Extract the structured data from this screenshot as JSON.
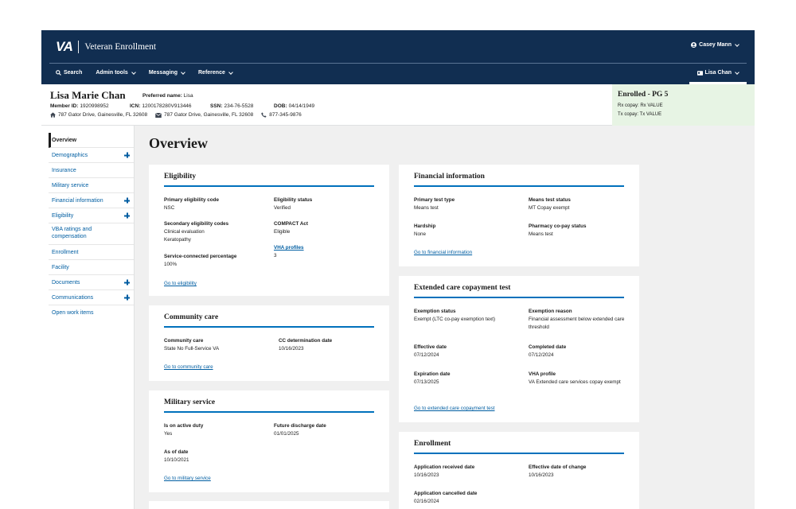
{
  "header": {
    "logo": "VA",
    "app_title": "Veteran Enrollment",
    "user_name": "Casey Mann",
    "nav": [
      "Search",
      "Admin tools",
      "Messaging",
      "Reference"
    ],
    "person_tab": "Lisa Chan"
  },
  "person": {
    "name": "Lisa Marie Chan",
    "preferred_label": "Preferred name:",
    "preferred_value": "Lisa",
    "member_id_label": "Member ID:",
    "member_id": "1920998952",
    "icn_label": "ICN:",
    "icn": "1200178280V913446",
    "ssn_label": "SSN:",
    "ssn": "234-76-5528",
    "dob_label": "DOB:",
    "dob": "04/14/1949",
    "home_address": "787 Gator Drive, Gainesville, FL 32608",
    "mail_address": "787 Gator Drive, Gainesville, FL 32608",
    "phone": "877-345-9876"
  },
  "status": {
    "title": "Enrolled - PG 5",
    "rx": "Rx copay: Rx VALUE",
    "tx": "Tx copay: Tx VALUE"
  },
  "sidebar": {
    "items": [
      {
        "label": "Overview"
      },
      {
        "label": "Demographics"
      },
      {
        "label": "Insurance"
      },
      {
        "label": "Military service"
      },
      {
        "label": "Financial information"
      },
      {
        "label": "Eligibility"
      },
      {
        "label": "VBA ratings and compensation"
      },
      {
        "label": "Enrollment"
      },
      {
        "label": "Facility"
      },
      {
        "label": "Documents"
      },
      {
        "label": "Communications"
      },
      {
        "label": "Open work items"
      }
    ]
  },
  "page_title": "Overview",
  "eligibility": {
    "title": "Eligibility",
    "primary_code_label": "Primary eligibility code",
    "primary_code": "NSC",
    "status_label": "Eligibility status",
    "status": "Verified",
    "secondary_label": "Secondary eligibility codes",
    "secondary_1": "Clinical evaluation",
    "secondary_2": "Keratopathy",
    "compact_label": "COMPACT Act",
    "compact": "Eligible",
    "vha_profiles_label": "VHA profiles",
    "vha_profiles": "3",
    "sc_pct_label": "Service-connected percentage",
    "sc_pct": "100%",
    "link": "Go to eligibility"
  },
  "community_care": {
    "title": "Community care",
    "cc_label": "Community care",
    "cc": "State No Full-Service VA",
    "cc_date_label": "CC determination date",
    "cc_date": "10/16/2023",
    "link": "Go to community care"
  },
  "military": {
    "title": "Military service",
    "active_label": "Is on active duty",
    "active": "Yes",
    "discharge_label": "Future discharge date",
    "discharge": "01/01/2025",
    "asof_label": "As of date",
    "asof": "10/10/2021",
    "link": "Go to military service"
  },
  "financial": {
    "title": "Financial information",
    "test_type_label": "Primary test type",
    "test_type": "Means test",
    "means_status_label": "Means test status",
    "means_status": "MT Copay exempt",
    "hardship_label": "Hardship",
    "hardship": "None",
    "pharm_label": "Pharmacy co-pay status",
    "pharm": "Means test",
    "link": "Go to financial information"
  },
  "extended": {
    "title": "Extended care copayment test",
    "exemption_status_label": "Exemption status",
    "exemption_status": "Exempt (LTC co-pay exemption text)",
    "exemption_reason_label": "Exemption reason",
    "exemption_reason": "Financial assessment below extended care threshold",
    "effective_label": "Effective date",
    "effective": "07/12/2024",
    "completed_label": "Completed date",
    "completed": "07/12/2024",
    "expiration_label": "Expiration date",
    "expiration": "07/13/2025",
    "vha_profile_label": "VHA profile",
    "vha_profile": "VA Extended care services copay exempt",
    "link": "Go to extended care copayment test"
  },
  "enrollment": {
    "title": "Enrollment",
    "received_label": "Application received date",
    "received": "10/16/2023",
    "change_label": "Effective date of change",
    "change": "10/16/2023",
    "cancelled_label": "Application cancelled date",
    "cancelled": "02/16/2024"
  },
  "colors": {
    "header_bg": "#112e51",
    "accent": "#0071bc",
    "link": "#005ea2",
    "status_bg": "#e7f4e4"
  }
}
